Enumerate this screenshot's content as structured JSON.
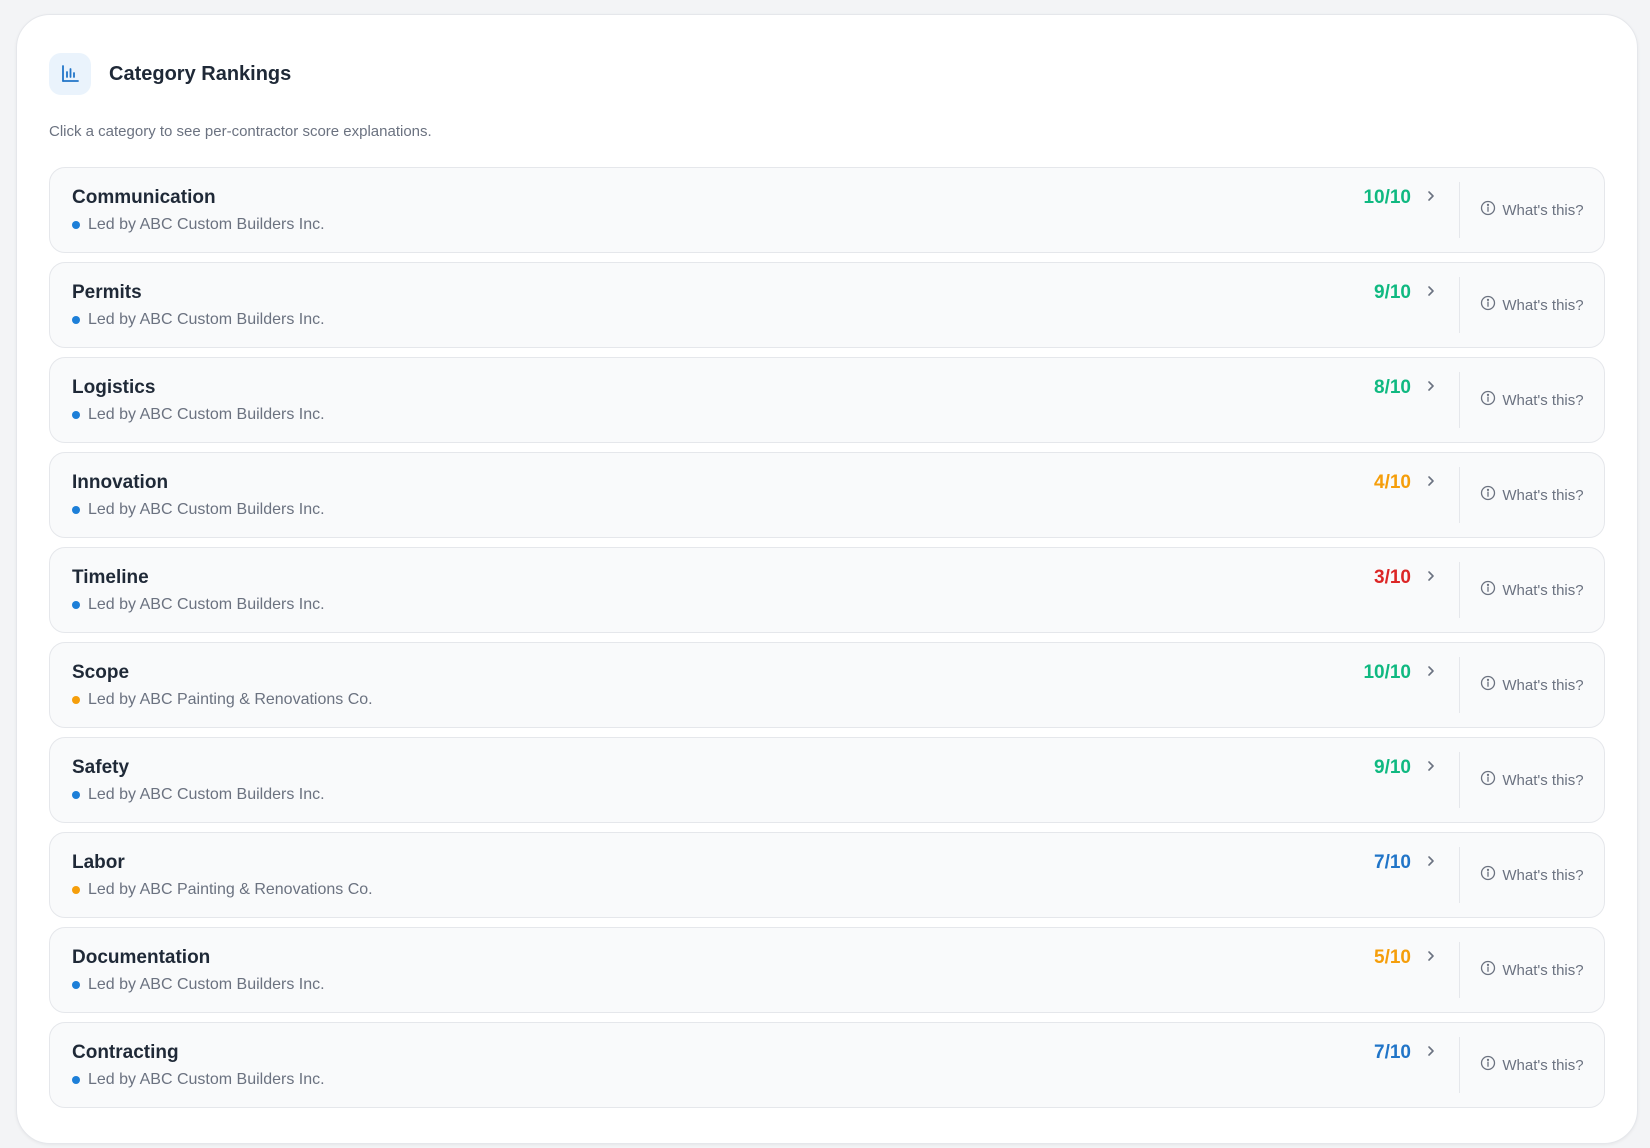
{
  "header": {
    "title": "Category Rankings",
    "icon": "bar-chart-icon",
    "subtitle": "Click a category to see per-contractor score explanations."
  },
  "colors": {
    "high": "#10b981",
    "mid": "#f59e0b",
    "low": "#dc2626",
    "neutral": "#2175c8",
    "dot_custom_builders": "#1d7fd8",
    "dot_painting": "#f59e0b"
  },
  "help_label": "What's this?",
  "categories": [
    {
      "name": "Communication",
      "leader": "Led by ABC Custom Builders Inc.",
      "score": "10/10",
      "score_color": "#10b981",
      "dot_color": "#1d7fd8"
    },
    {
      "name": "Permits",
      "leader": "Led by ABC Custom Builders Inc.",
      "score": "9/10",
      "score_color": "#10b981",
      "dot_color": "#1d7fd8"
    },
    {
      "name": "Logistics",
      "leader": "Led by ABC Custom Builders Inc.",
      "score": "8/10",
      "score_color": "#10b981",
      "dot_color": "#1d7fd8"
    },
    {
      "name": "Innovation",
      "leader": "Led by ABC Custom Builders Inc.",
      "score": "4/10",
      "score_color": "#f59e0b",
      "dot_color": "#1d7fd8"
    },
    {
      "name": "Timeline",
      "leader": "Led by ABC Custom Builders Inc.",
      "score": "3/10",
      "score_color": "#dc2626",
      "dot_color": "#1d7fd8"
    },
    {
      "name": "Scope",
      "leader": "Led by ABC Painting & Renovations Co.",
      "score": "10/10",
      "score_color": "#10b981",
      "dot_color": "#f59e0b"
    },
    {
      "name": "Safety",
      "leader": "Led by ABC Custom Builders Inc.",
      "score": "9/10",
      "score_color": "#10b981",
      "dot_color": "#1d7fd8"
    },
    {
      "name": "Labor",
      "leader": "Led by ABC Painting & Renovations Co.",
      "score": "7/10",
      "score_color": "#2175c8",
      "dot_color": "#f59e0b"
    },
    {
      "name": "Documentation",
      "leader": "Led by ABC Custom Builders Inc.",
      "score": "5/10",
      "score_color": "#f59e0b",
      "dot_color": "#1d7fd8"
    },
    {
      "name": "Contracting",
      "leader": "Led by ABC Custom Builders Inc.",
      "score": "7/10",
      "score_color": "#2175c8",
      "dot_color": "#1d7fd8"
    }
  ]
}
